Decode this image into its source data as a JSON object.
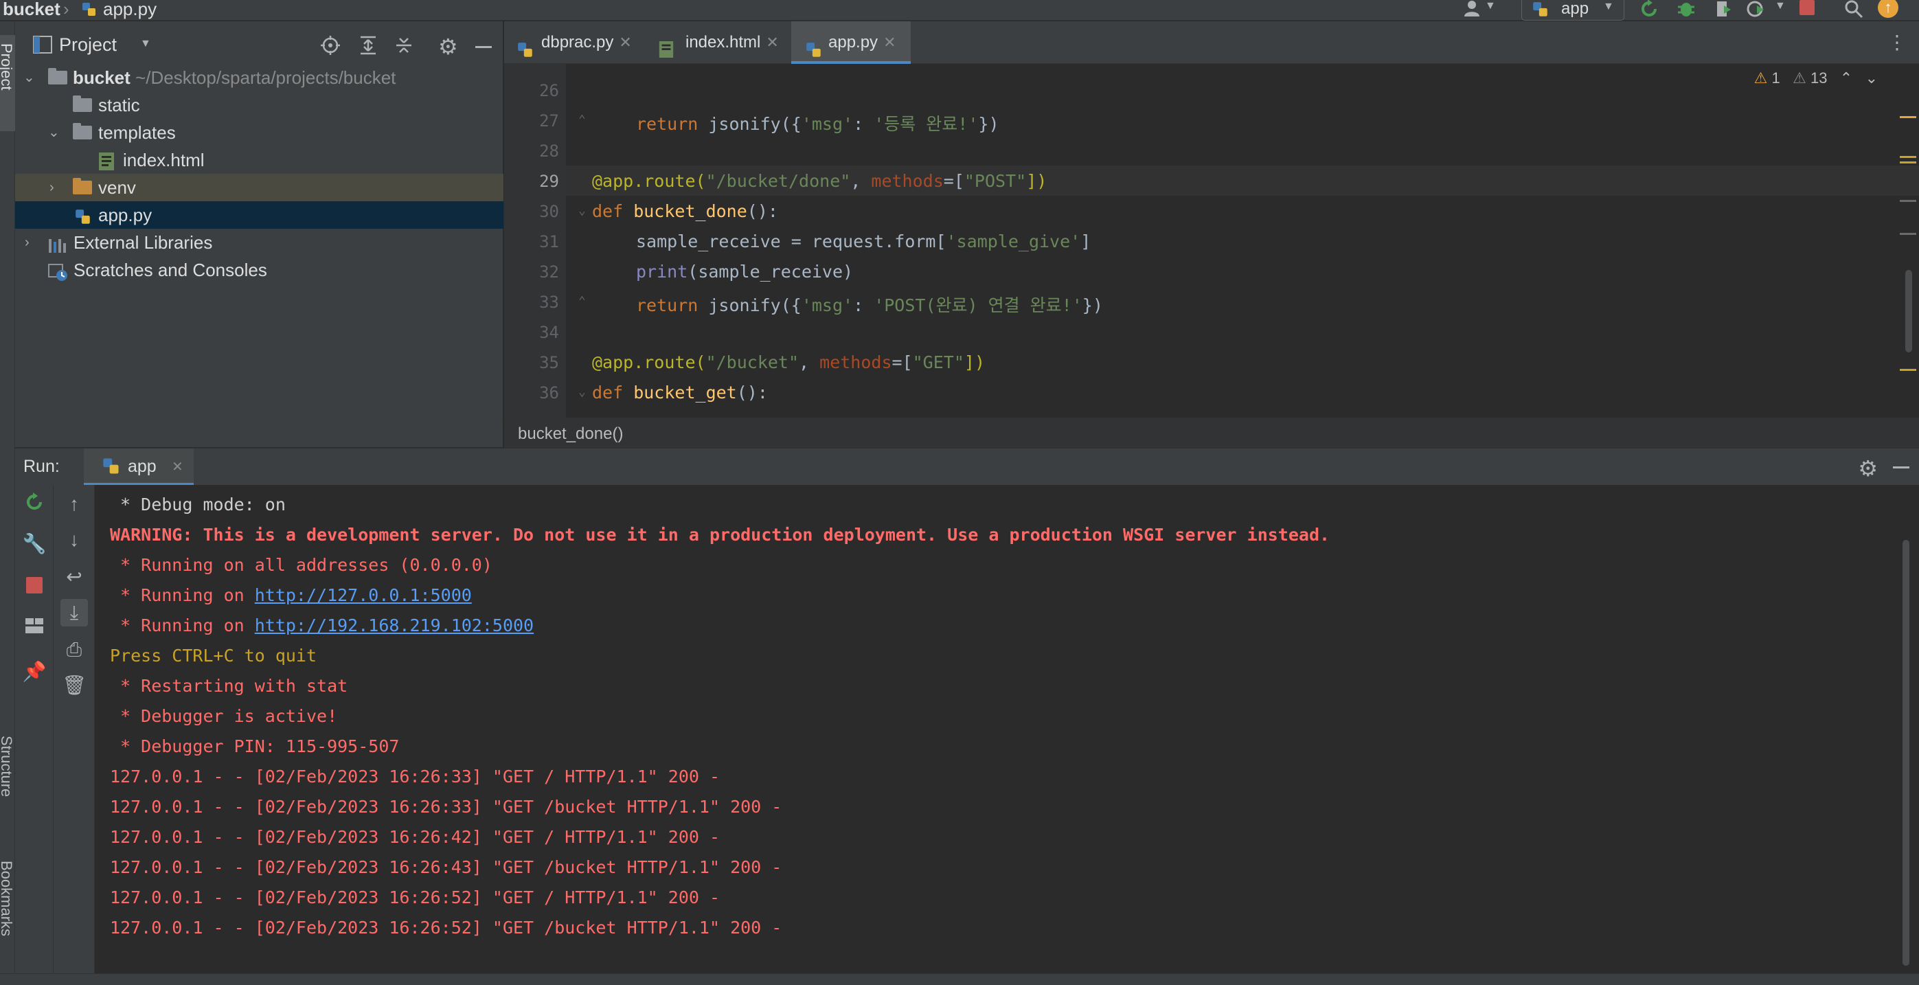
{
  "navbar": {
    "crumbs": [
      "bucket",
      "app.py"
    ],
    "run_config": "app"
  },
  "left_stripe": {
    "project_label": "Project",
    "structure_label": "Structure",
    "bookmarks_label": "Bookmarks"
  },
  "project": {
    "title": "Project",
    "tree": [
      {
        "label": "bucket",
        "sub": "~/Desktop/sparta/projects/bucket"
      },
      {
        "label": "static"
      },
      {
        "label": "templates"
      },
      {
        "label": "index.html"
      },
      {
        "label": "venv"
      },
      {
        "label": "app.py"
      },
      {
        "label": "External Libraries"
      },
      {
        "label": "Scratches and Consoles"
      }
    ]
  },
  "tabs": [
    {
      "label": "dbprac.py"
    },
    {
      "label": "index.html"
    },
    {
      "label": "app.py"
    }
  ],
  "editor": {
    "line_numbers": [
      "26",
      "27",
      "28",
      "29",
      "30",
      "31",
      "32",
      "33",
      "34",
      "35",
      "36"
    ],
    "warnings_count": "1",
    "weak_warnings_count": "13",
    "breadcrumb": "bucket_done()",
    "code": {
      "l27_a": "return",
      "l27_b": " jsonify({",
      "l27_c": "'msg'",
      "l27_d": ": ",
      "l27_e": "'등록 완료!'",
      "l27_f": "})",
      "l29_a": "@app.route(",
      "l29_b": "\"/bucket/done\"",
      "l29_c": ", ",
      "l29_d": "methods",
      "l29_e": "=[",
      "l29_f": "\"POST\"",
      "l29_g": "])",
      "l30_a": "def",
      "l30_b": " bucket_done",
      "l30_c": "():",
      "l31_a": "sample_receive = request.form[",
      "l31_b": "'sample_give'",
      "l31_c": "]",
      "l32_a": "print",
      "l32_b": "(sample_receive)",
      "l33_a": "return",
      "l33_b": " jsonify({",
      "l33_c": "'msg'",
      "l33_d": ": ",
      "l33_e": "'POST(완료) 연결 완료!'",
      "l33_f": "})",
      "l35_a": "@app.route(",
      "l35_b": "\"/bucket\"",
      "l35_c": ", ",
      "l35_d": "methods",
      "l35_e": "=[",
      "l35_f": "\"GET\"",
      "l35_g": "])",
      "l36_a": "def",
      "l36_b": " bucket_get",
      "l36_c": "():"
    }
  },
  "run": {
    "label": "Run:",
    "tab": "app",
    "console": {
      "debug": " * Debug mode: on",
      "warning": "WARNING: This is a development server. Do not use it in a production deployment. Use a production WSGI server instead.",
      "running_all": " * Running on all addresses (0.0.0.0)",
      "running_prefix": " * Running on ",
      "url_local": "http://127.0.0.1:5000",
      "url_lan": "http://192.168.219.102:5000",
      "quit": "Press CTRL+C to quit",
      "restart": " * Restarting with stat",
      "debugger": " * Debugger is active!",
      "pin": " * Debugger PIN: 115-995-507",
      "requests": [
        "127.0.0.1 - - [02/Feb/2023 16:26:33] \"GET / HTTP/1.1\" 200 -",
        "127.0.0.1 - - [02/Feb/2023 16:26:33] \"GET /bucket HTTP/1.1\" 200 -",
        "127.0.0.1 - - [02/Feb/2023 16:26:42] \"GET / HTTP/1.1\" 200 -",
        "127.0.0.1 - - [02/Feb/2023 16:26:43] \"GET /bucket HTTP/1.1\" 200 -",
        "127.0.0.1 - - [02/Feb/2023 16:26:52] \"GET / HTTP/1.1\" 200 -",
        "127.0.0.1 - - [02/Feb/2023 16:26:52] \"GET /bucket HTTP/1.1\" 200 -"
      ]
    }
  },
  "colors": {
    "accent": "#4a88c7",
    "error_text": "#ff6b68",
    "link": "#589df6",
    "warning_text": "#c9a226",
    "stop_red": "#c75450",
    "run_green": "#499c54"
  },
  "icons": [
    "python-file-icon",
    "html-file-icon",
    "folder-icon",
    "crosshair-icon",
    "expand-all-icon",
    "collapse-all-icon",
    "gear-icon",
    "minimize-icon",
    "rerun-icon",
    "stop-icon",
    "wrench-icon",
    "pin-icon",
    "up-arrow-icon",
    "down-arrow-icon",
    "soft-wrap-icon",
    "scroll-to-end-icon",
    "print-icon",
    "trash-icon",
    "search-icon",
    "user-icon",
    "debug-icon",
    "warning-icon"
  ]
}
